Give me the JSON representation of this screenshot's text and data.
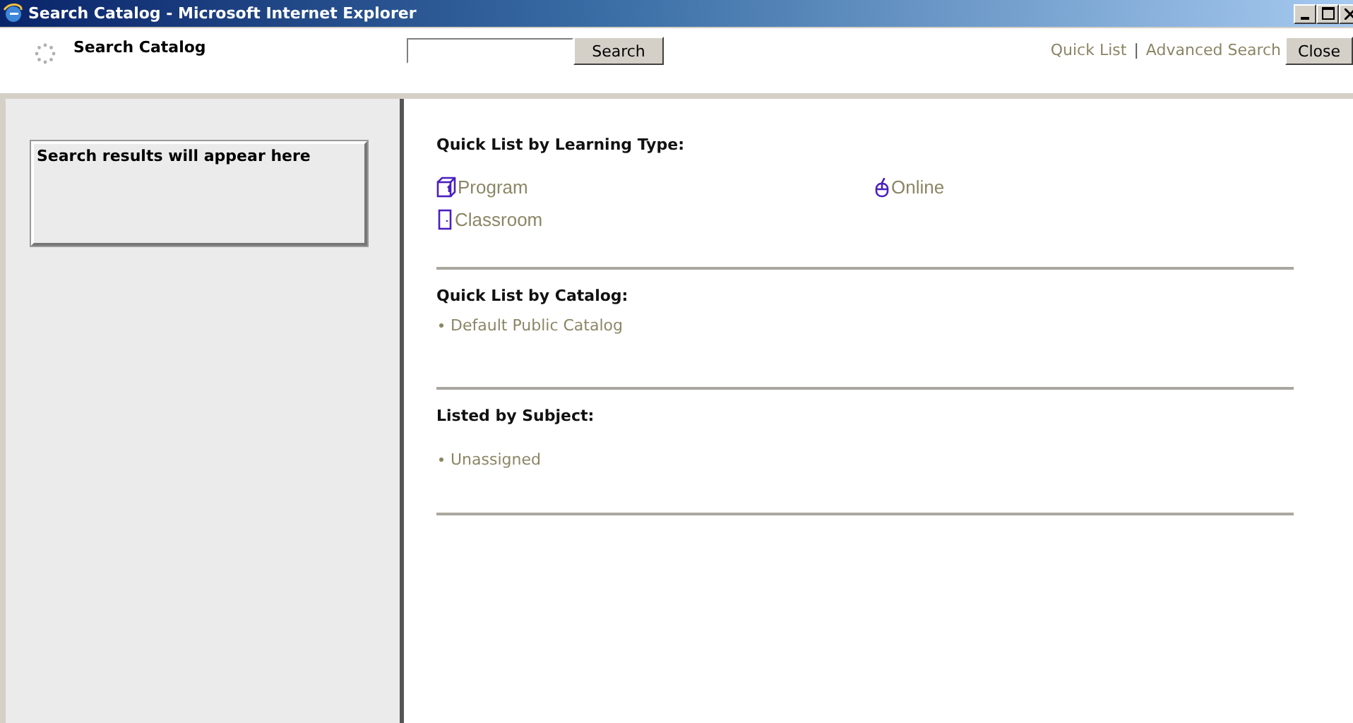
{
  "window": {
    "title": "Search Catalog - Microsoft Internet Explorer"
  },
  "header": {
    "title": "Search Catalog",
    "search": {
      "button": "Search"
    },
    "links": [
      "Quick List",
      "Advanced Search"
    ],
    "separator": "|",
    "close": "Close"
  },
  "sidebar": {
    "results_note": "Search results will appear here"
  },
  "sections": [
    {
      "heading": "Quick List by Learning Type:",
      "kind": "types",
      "items": [
        {
          "label": "Program",
          "kind": "program"
        },
        {
          "label": "Online",
          "kind": "online"
        },
        {
          "label": "Classroom",
          "kind": "classroom"
        }
      ]
    },
    {
      "heading": "Quick List by Catalog:",
      "kind": "bullets",
      "items": [
        {
          "label": "Default Public Catalog"
        }
      ]
    },
    {
      "heading": "Listed by Subject:",
      "kind": "bullets",
      "items": [
        {
          "label": "Unassigned"
        }
      ]
    }
  ]
}
